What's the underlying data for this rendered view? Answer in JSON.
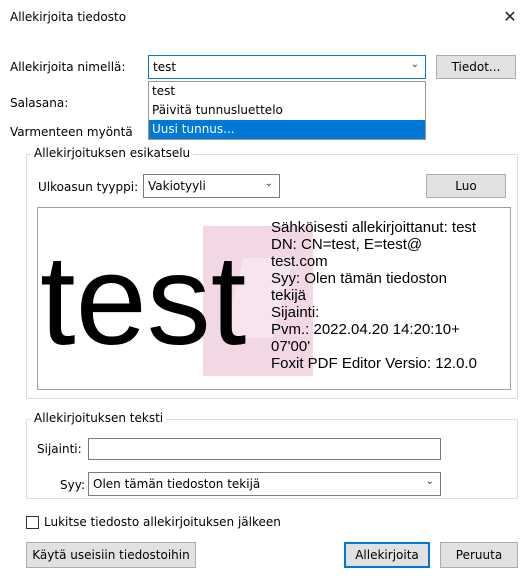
{
  "window": {
    "title": "Allekirjoita tiedosto",
    "close": "✕"
  },
  "signer": {
    "label": "Allekirjoita nimellä:",
    "value": "test",
    "details_button": "Tiedot..."
  },
  "dropdown": {
    "options": [
      "test",
      "Päivitä tunnusluettelo",
      "Uusi tunnus..."
    ],
    "highlighted": "Uusi tunnus..."
  },
  "password": {
    "label": "Salasana:"
  },
  "issuer": {
    "label": "Varmenteen myöntä"
  },
  "preview_group": {
    "title": "Allekirjoituksen esikatselu",
    "style_label": "Ulkoasun tyyppi:",
    "style_value": "Vakiotyyli",
    "create_button": "Luo",
    "signature_name": "test",
    "info_lines": [
      "Sähköisesti allekirjoittanut: test",
      "DN: CN=test, E=test@",
      "test.com",
      "Syy: Olen tämän tiedoston",
      "tekijä",
      "Sijainti:",
      "Pvm.: 2022.04.20 14:20:10+",
      "07'00'",
      "Foxit PDF Editor Versio: 12.0.0"
    ]
  },
  "text_group": {
    "title": "Allekirjoituksen teksti",
    "location_label": "Sijainti:",
    "location_value": "",
    "reason_label": "Syy:",
    "reason_value": "Olen tämän tiedoston tekijä"
  },
  "lock": {
    "label": "Lukitse tiedosto allekirjoituksen jälkeen",
    "checked": false
  },
  "buttons": {
    "apply_multiple": "Käytä useisiin tiedostoihin",
    "sign": "Allekirjoita",
    "cancel": "Peruuta"
  },
  "colors": {
    "accent": "#0078d7",
    "watermark": "#e8b8cf"
  }
}
